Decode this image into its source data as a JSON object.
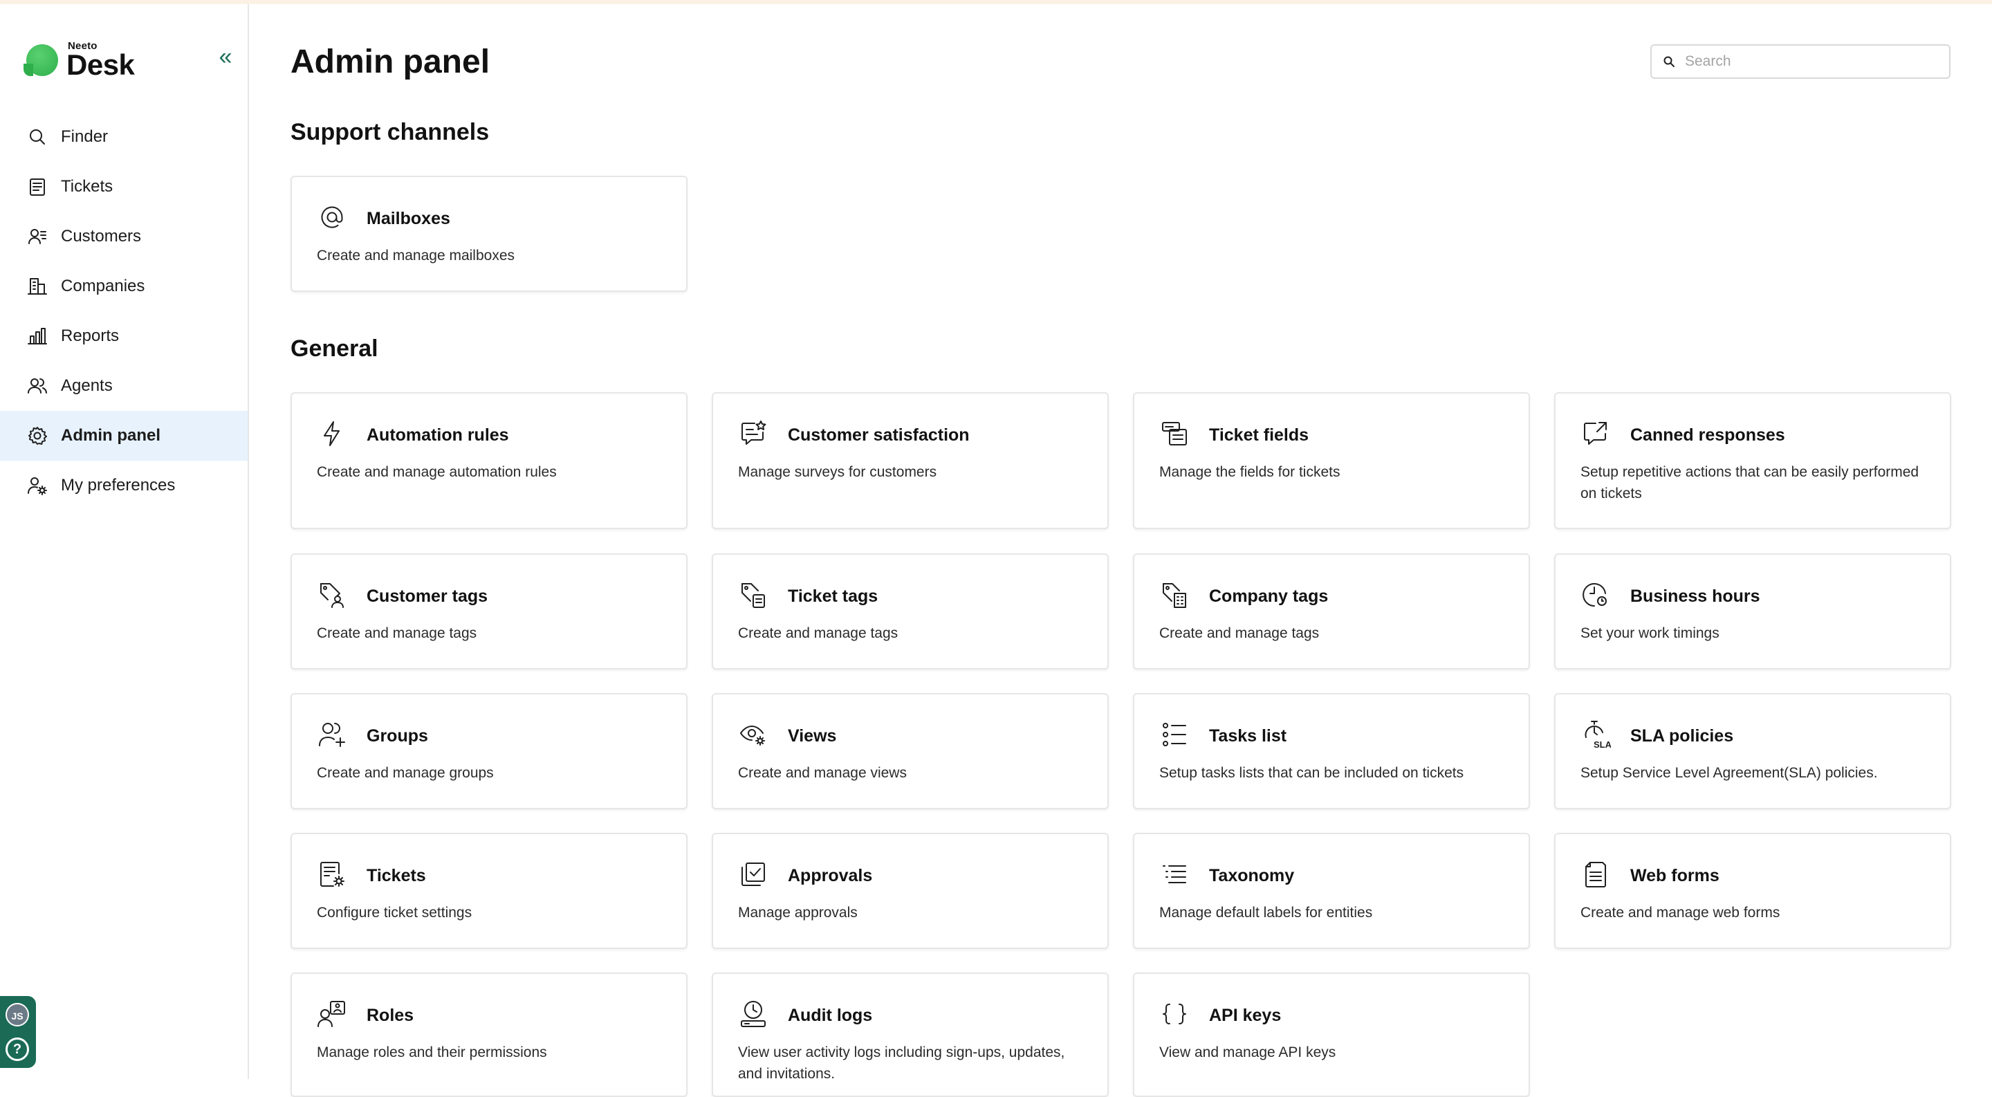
{
  "brand": {
    "top": "Neeto",
    "name": "Desk"
  },
  "sidebar": {
    "items": [
      {
        "label": "Finder",
        "icon": "search-icon"
      },
      {
        "label": "Tickets",
        "icon": "ticket-icon"
      },
      {
        "label": "Customers",
        "icon": "customers-icon"
      },
      {
        "label": "Companies",
        "icon": "building-icon"
      },
      {
        "label": "Reports",
        "icon": "bar-chart-icon"
      },
      {
        "label": "Agents",
        "icon": "agents-icon"
      },
      {
        "label": "Admin panel",
        "icon": "gear-icon",
        "active": true
      },
      {
        "label": "My preferences",
        "icon": "user-gear-icon"
      }
    ],
    "user_initials": "JS",
    "help_symbol": "?"
  },
  "header": {
    "title": "Admin panel",
    "search_placeholder": "Search"
  },
  "sections": [
    {
      "title": "Support channels",
      "cards": [
        {
          "title": "Mailboxes",
          "desc": "Create and manage mailboxes",
          "icon": "at-icon"
        }
      ]
    },
    {
      "title": "General",
      "cards": [
        {
          "title": "Automation rules",
          "desc": "Create and manage automation rules",
          "icon": "lightning-icon"
        },
        {
          "title": "Customer satisfaction",
          "desc": "Manage surveys for customers",
          "icon": "survey-icon"
        },
        {
          "title": "Ticket fields",
          "desc": "Manage the fields for tickets",
          "icon": "ticket-fields-icon"
        },
        {
          "title": "Canned responses",
          "desc": "Setup repetitive actions that can be easily performed on tickets",
          "icon": "canned-response-icon"
        },
        {
          "title": "Customer tags",
          "desc": "Create and manage tags",
          "icon": "customer-tag-icon"
        },
        {
          "title": "Ticket tags",
          "desc": "Create and manage tags",
          "icon": "ticket-tag-icon"
        },
        {
          "title": "Company tags",
          "desc": "Create and manage tags",
          "icon": "company-tag-icon"
        },
        {
          "title": "Business hours",
          "desc": "Set your work timings",
          "icon": "clock-icon"
        },
        {
          "title": "Groups",
          "desc": "Create and manage groups",
          "icon": "group-add-icon"
        },
        {
          "title": "Views",
          "desc": "Create and manage views",
          "icon": "eye-gear-icon"
        },
        {
          "title": "Tasks list",
          "desc": "Setup tasks lists that can be included on tickets",
          "icon": "task-list-icon"
        },
        {
          "title": "SLA policies",
          "desc": "Setup Service Level Agreement(SLA) policies.",
          "icon": "sla-timer-icon"
        },
        {
          "title": "Tickets",
          "desc": "Configure ticket settings",
          "icon": "ticket-settings-icon"
        },
        {
          "title": "Approvals",
          "desc": "Manage approvals",
          "icon": "approval-icon"
        },
        {
          "title": "Taxonomy",
          "desc": "Manage default labels for entities",
          "icon": "taxonomy-icon"
        },
        {
          "title": "Web forms",
          "desc": "Create and manage web forms",
          "icon": "web-form-icon"
        },
        {
          "title": "Roles",
          "desc": "Manage roles and their permissions",
          "icon": "roles-icon"
        },
        {
          "title": "Audit logs",
          "desc": "View user activity logs including sign-ups, updates, and invitations.",
          "icon": "audit-log-icon"
        },
        {
          "title": "API keys",
          "desc": "View and manage API keys",
          "icon": "braces-icon"
        }
      ]
    }
  ]
}
